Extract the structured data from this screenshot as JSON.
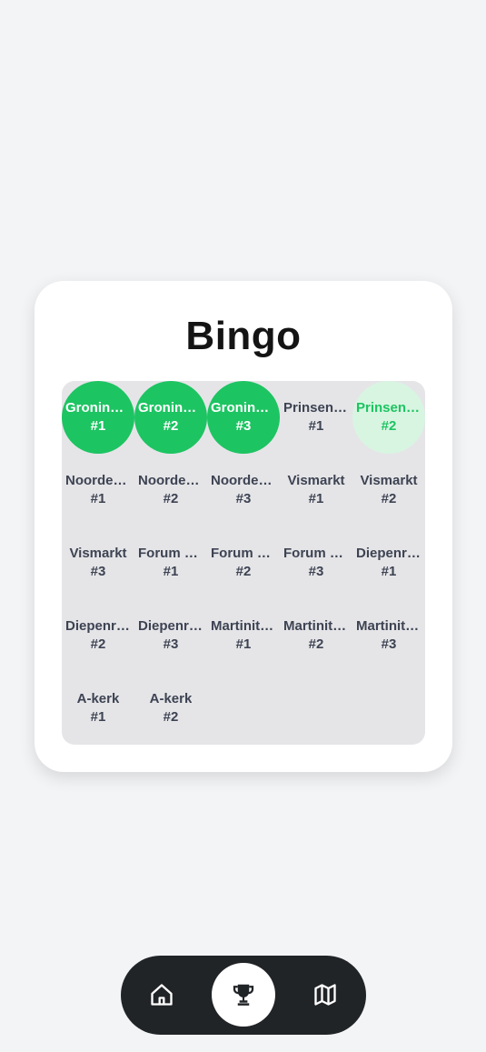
{
  "title": "Bingo",
  "colors": {
    "found": "#1dc462",
    "partial": "#d8f5e1",
    "text": "#3d4352",
    "nav_bg": "#212427"
  },
  "cells": [
    {
      "name": "Groningen",
      "num": "#1",
      "state": "found"
    },
    {
      "name": "Groningen",
      "num": "#2",
      "state": "found"
    },
    {
      "name": "Groningen",
      "num": "#3",
      "state": "found"
    },
    {
      "name": "Prinsentuin",
      "num": "#1",
      "state": "none"
    },
    {
      "name": "Prinsentuin",
      "num": "#2",
      "state": "partial"
    },
    {
      "name": "Noorderplantsoen",
      "num": "#1",
      "state": "none"
    },
    {
      "name": "Noorderplantsoen",
      "num": "#2",
      "state": "none"
    },
    {
      "name": "Noorderplantsoen",
      "num": "#3",
      "state": "none"
    },
    {
      "name": "Vismarkt",
      "num": "#1",
      "state": "none"
    },
    {
      "name": "Vismarkt",
      "num": "#2",
      "state": "none"
    },
    {
      "name": "Vismarkt",
      "num": "#3",
      "state": "none"
    },
    {
      "name": "Forum Groningen",
      "num": "#1",
      "state": "none"
    },
    {
      "name": "Forum Groningen",
      "num": "#2",
      "state": "none"
    },
    {
      "name": "Forum Groningen",
      "num": "#3",
      "state": "none"
    },
    {
      "name": "Diepenring",
      "num": "#1",
      "state": "none"
    },
    {
      "name": "Diepenring",
      "num": "#2",
      "state": "none"
    },
    {
      "name": "Diepenring",
      "num": "#3",
      "state": "none"
    },
    {
      "name": "Martinitoren",
      "num": "#1",
      "state": "none"
    },
    {
      "name": "Martinitoren",
      "num": "#2",
      "state": "none"
    },
    {
      "name": "Martinitoren",
      "num": "#3",
      "state": "none"
    },
    {
      "name": "A-kerk",
      "num": "#1",
      "state": "none"
    },
    {
      "name": "A-kerk",
      "num": "#2",
      "state": "none"
    }
  ],
  "nav": {
    "items": [
      {
        "icon": "home-icon",
        "active": false
      },
      {
        "icon": "trophy-icon",
        "active": true
      },
      {
        "icon": "map-icon",
        "active": false
      }
    ]
  }
}
